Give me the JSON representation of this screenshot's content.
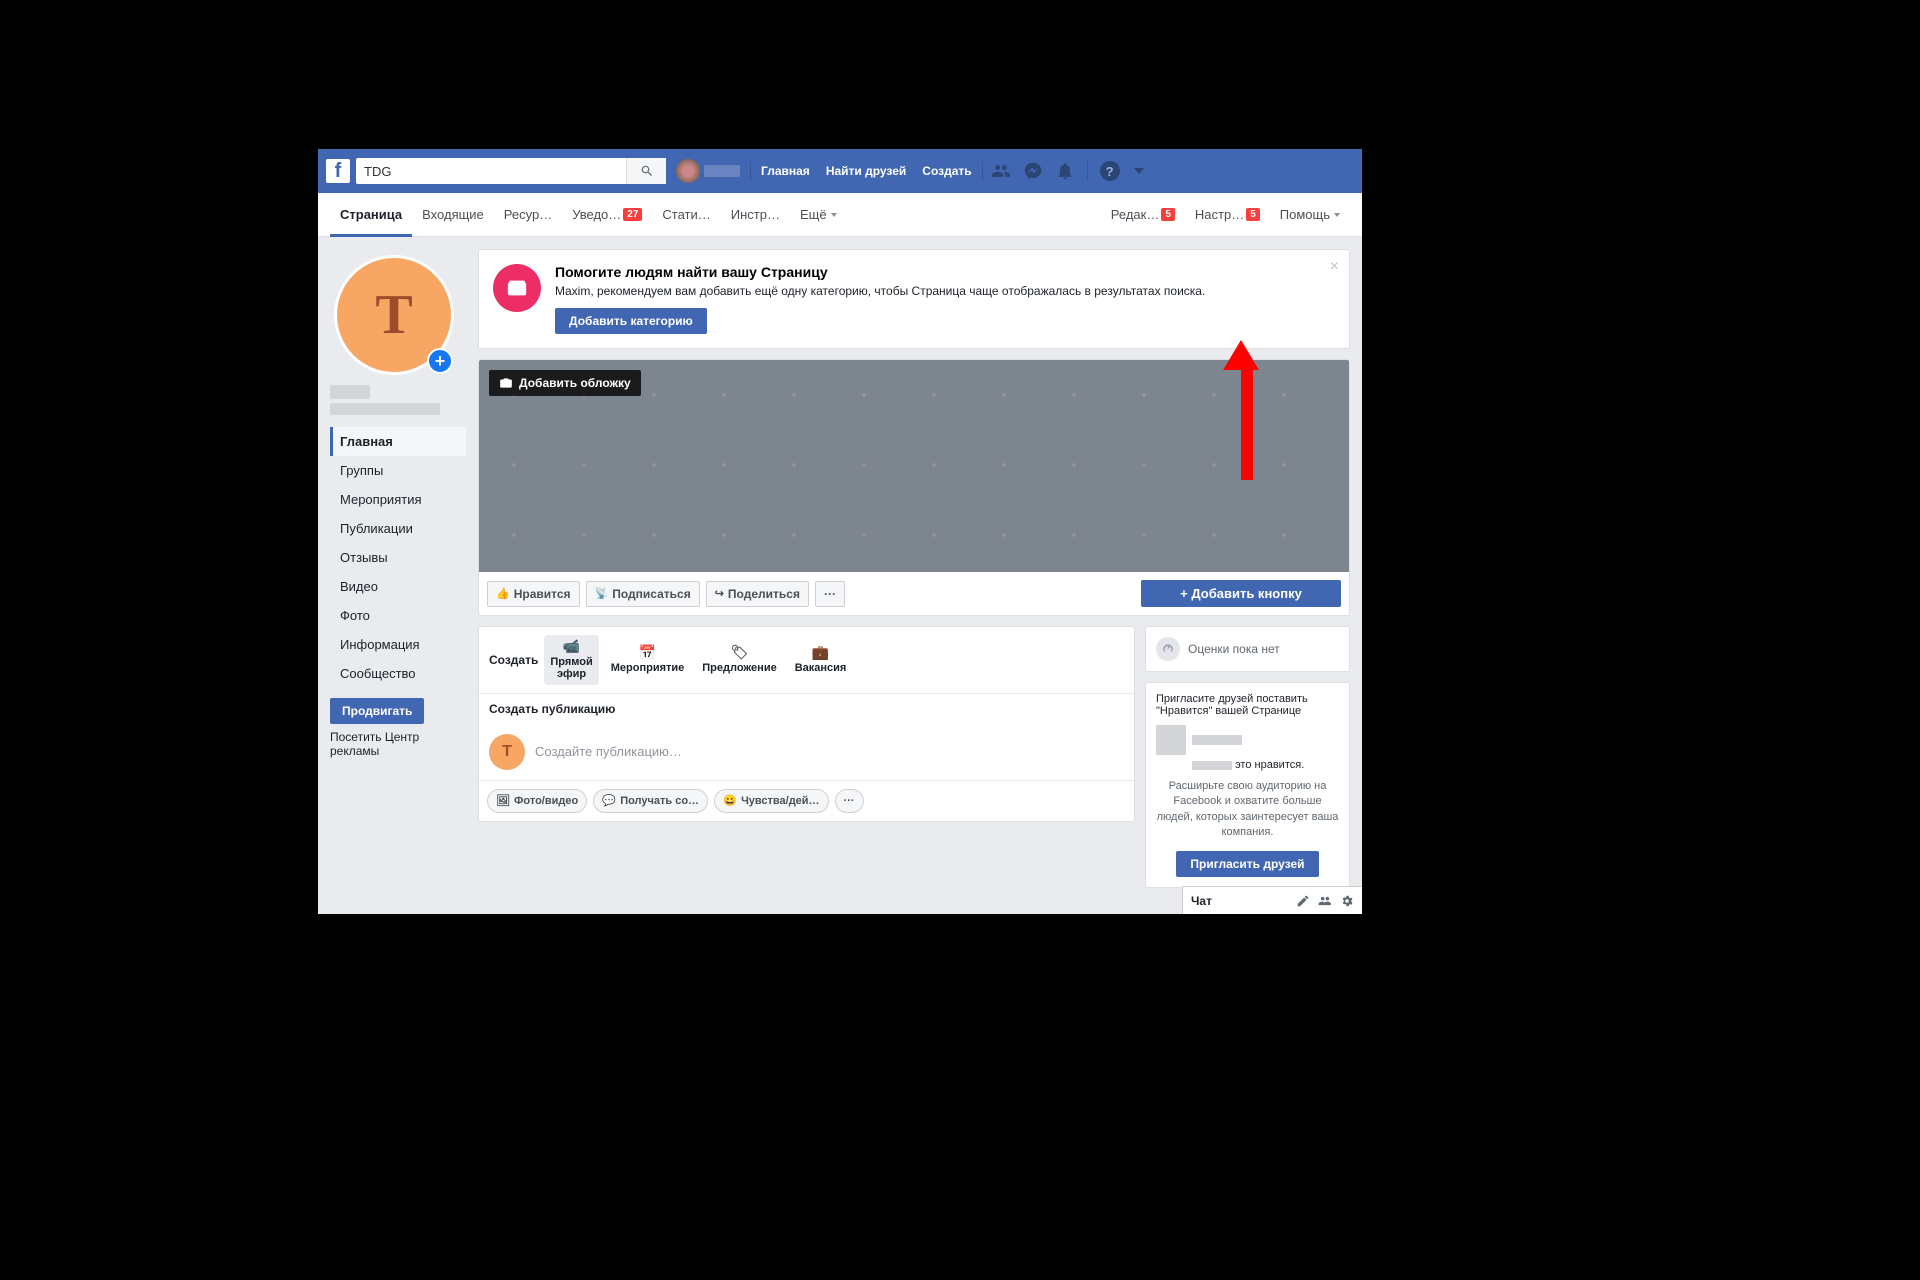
{
  "topbar": {
    "search_value": "TDG",
    "links": {
      "home": "Главная",
      "friends": "Найти друзей",
      "create": "Создать"
    }
  },
  "pagetabs": {
    "items": [
      {
        "label": "Страница",
        "active": true
      },
      {
        "label": "Входящие"
      },
      {
        "label": "Ресур…"
      },
      {
        "label": "Уведо…",
        "badge": "27"
      },
      {
        "label": "Стати…"
      },
      {
        "label": "Инстр…"
      },
      {
        "label": "Ещё",
        "caret": true
      }
    ],
    "right": [
      {
        "label": "Редак…",
        "badge": "5"
      },
      {
        "label": "Настр…",
        "badge": "5"
      },
      {
        "label": "Помощь",
        "caret": true
      }
    ]
  },
  "profile": {
    "letter": "T"
  },
  "leftnav": {
    "items": [
      "Главная",
      "Группы",
      "Мероприятия",
      "Публикации",
      "Отзывы",
      "Видео",
      "Фото",
      "Информация",
      "Сообщество"
    ],
    "promote": "Продвигать",
    "adcenter": "Посетить Центр рекламы"
  },
  "tip": {
    "title": "Помогите людям найти вашу Страницу",
    "body": "Maxim, рекомендуем вам добавить ещё одну категорию, чтобы Страница чаще отображалась в результатах поиска.",
    "button": "Добавить категорию"
  },
  "cover": {
    "add": "Добавить обложку"
  },
  "actions": {
    "like": "Нравится",
    "follow": "Подписаться",
    "share": "Поделиться",
    "add": "+ Добавить кнопку"
  },
  "create": {
    "label": "Создать",
    "opts": [
      {
        "label": "Прямой\nэфир",
        "sel": true
      },
      {
        "label": "Мероприятие"
      },
      {
        "label": "Предложение"
      },
      {
        "label": "Вакансия"
      }
    ],
    "section": "Создать публикацию",
    "placeholder": "Создайте публикацию…",
    "chips": [
      "Фото/видео",
      "Получать со…",
      "Чувства/дей…"
    ]
  },
  "rating": {
    "text": "Оценки пока нет"
  },
  "invite": {
    "hint": "Пригласите друзей поставить \"Нравится\" вашей Странице",
    "likes_suffix": "это нравится.",
    "desc": "Расширьте свою аудиторию на Facebook и охватите больше людей, которых заинтересует ваша компания.",
    "button": "Пригласить друзей"
  },
  "chat": {
    "label": "Чат"
  }
}
